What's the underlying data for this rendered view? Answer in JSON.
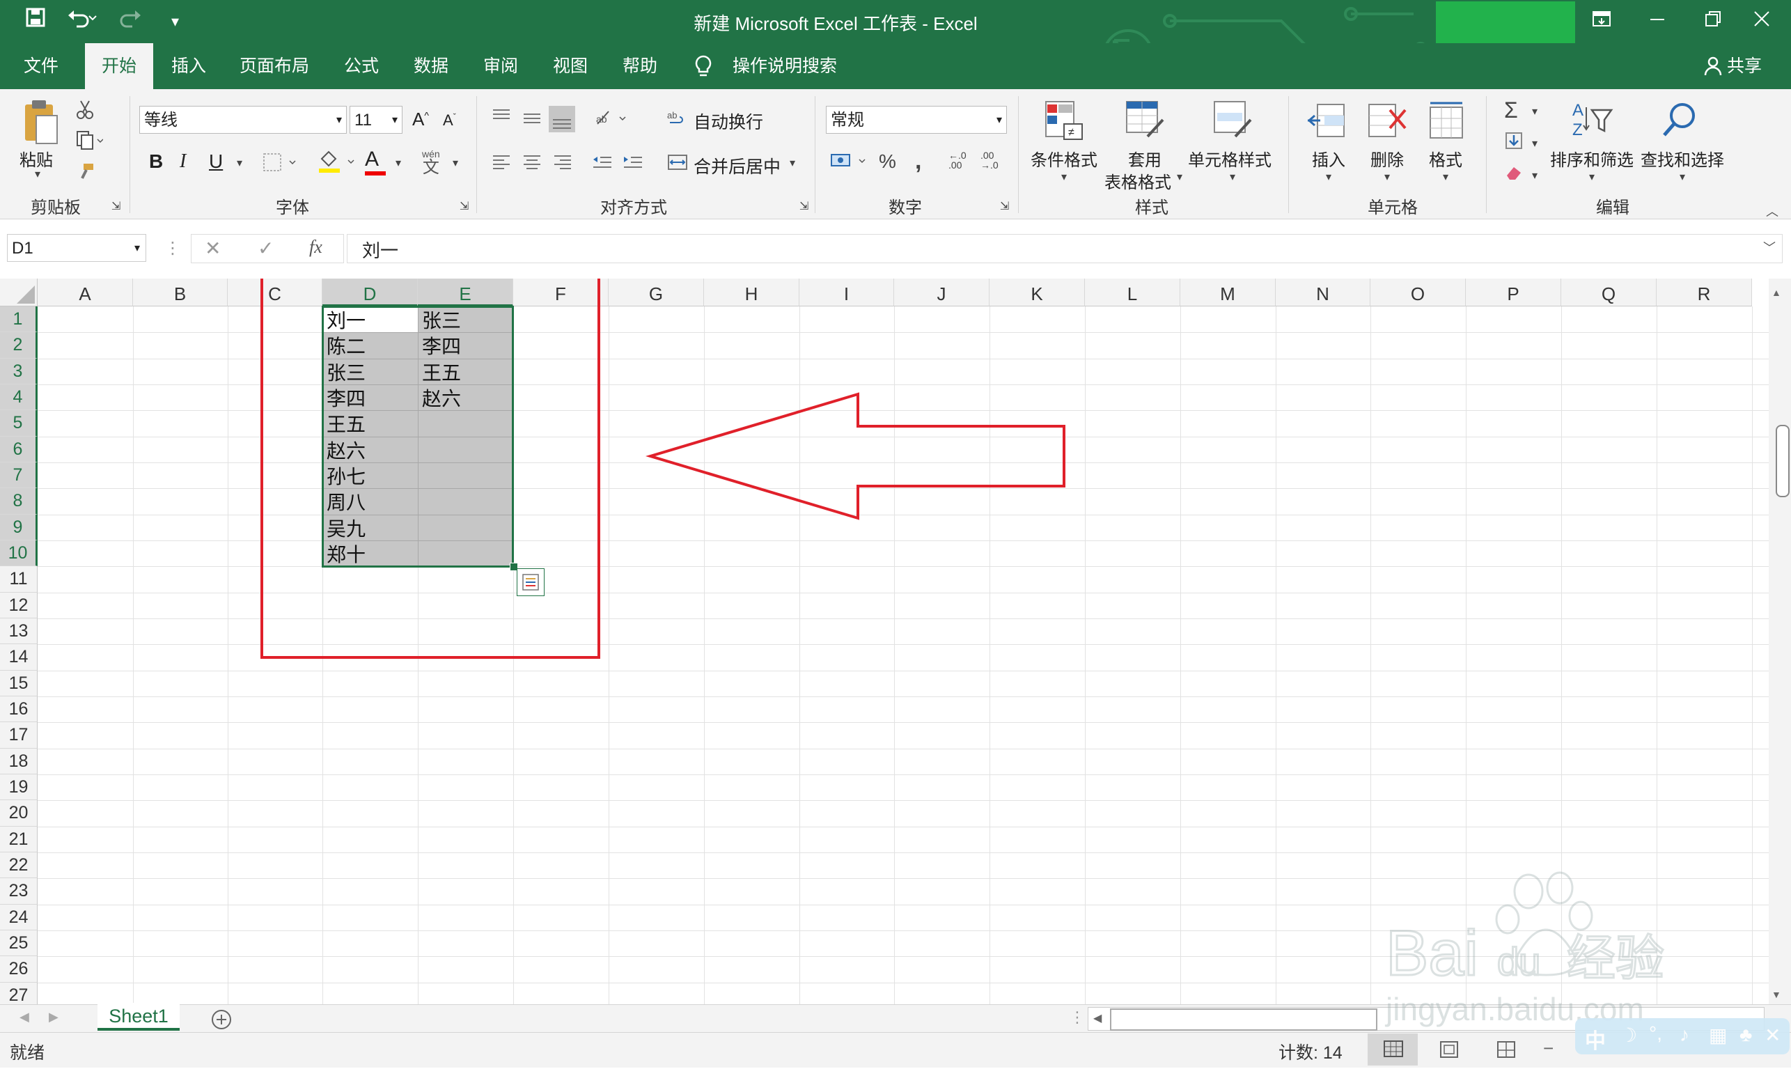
{
  "window": {
    "title": "新建 Microsoft Excel 工作表  -  Excel",
    "share_label": "共享"
  },
  "ribbon_tabs": [
    {
      "label": "文件"
    },
    {
      "label": "开始"
    },
    {
      "label": "插入"
    },
    {
      "label": "页面布局"
    },
    {
      "label": "公式"
    },
    {
      "label": "数据"
    },
    {
      "label": "审阅"
    },
    {
      "label": "视图"
    },
    {
      "label": "帮助"
    }
  ],
  "tell_me": "操作说明搜索",
  "ribbon": {
    "clipboard": {
      "paste": "粘贴",
      "group": "剪贴板"
    },
    "font": {
      "name": "等线",
      "size": "11",
      "bold": "B",
      "italic": "I",
      "underline": "U",
      "color_glyph": "A",
      "wen": "wén",
      "group": "字体"
    },
    "alignment": {
      "wrap": "自动换行",
      "merge": "合并后居中",
      "group": "对齐方式"
    },
    "number": {
      "format": "常规",
      "percent": "%",
      "comma": ",",
      "group": "数字"
    },
    "styles": {
      "conditional": "条件格式",
      "table_line1": "套用",
      "table_line2": "表格格式",
      "cell_styles": "单元格样式",
      "group": "样式"
    },
    "cells": {
      "insert": "插入",
      "delete": "删除",
      "format": "格式",
      "group": "单元格"
    },
    "editing": {
      "sort": "排序和筛选",
      "find": "查找和选择",
      "group": "编辑"
    }
  },
  "formula_bar": {
    "name_box": "D1",
    "fx": "fx",
    "value": "刘一"
  },
  "columns": [
    "A",
    "B",
    "C",
    "D",
    "E",
    "F",
    "G",
    "H",
    "I",
    "J",
    "K",
    "L",
    "M",
    "N",
    "O",
    "P",
    "Q",
    "R"
  ],
  "rows": [
    "1",
    "2",
    "3",
    "4",
    "5",
    "6",
    "7",
    "8",
    "9",
    "10",
    "11",
    "12",
    "13",
    "14",
    "15",
    "16",
    "17",
    "18",
    "19",
    "20",
    "21",
    "22",
    "23",
    "24",
    "25",
    "26",
    "27"
  ],
  "cells": {
    "D": [
      "刘一",
      "陈二",
      "张三",
      "李四",
      "王五",
      "赵六",
      "孙七",
      "周八",
      "吴九",
      "郑十"
    ],
    "E": [
      "张三",
      "李四",
      "王五",
      "赵六"
    ]
  },
  "sheet_tab": "Sheet1",
  "status": {
    "ready": "就绪",
    "count": "计数: 14"
  },
  "colors": {
    "excel_green": "#217346",
    "selection_fill": "#c6c6c6",
    "annotation_red": "#e0202a"
  }
}
